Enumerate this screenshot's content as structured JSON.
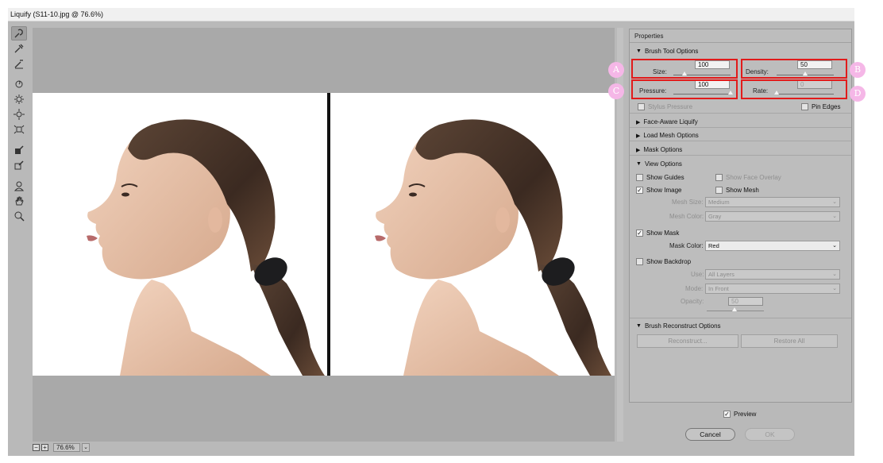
{
  "window": {
    "title": "Liquify (S11-10.jpg @ 76.6%)"
  },
  "toolbar": {
    "tools": [
      "forward-warp-icon",
      "reconstruct-icon",
      "smooth-icon",
      "twirl-icon",
      "pucker-icon",
      "bloat-icon",
      "push-left-icon",
      "freeze-mask-icon",
      "thaw-mask-icon",
      "face-tool-icon",
      "hand-icon",
      "zoom-icon"
    ]
  },
  "canvas": {
    "zoom_value": "76.6%",
    "zoom_out": "−",
    "zoom_in": "+",
    "dropdown_caret": "⌄"
  },
  "properties": {
    "title": "Properties",
    "brush_tool_options": {
      "heading": "Brush Tool Options",
      "size_label": "Size:",
      "size_value": "100",
      "size_level": 0.2,
      "density_label": "Density:",
      "density_value": "50",
      "density_level": 0.5,
      "pressure_label": "Pressure:",
      "pressure_value": "100",
      "pressure_level": 1.0,
      "rate_label": "Rate:",
      "rate_value": "0",
      "rate_level": 0.0,
      "stylus_pressure_label": "Stylus Pressure",
      "pin_edges_label": "Pin Edges"
    },
    "callouts": [
      "A",
      "B",
      "C",
      "D"
    ],
    "face_aware": "Face-Aware Liquify",
    "load_mesh": "Load Mesh Options",
    "mask_options": "Mask Options",
    "view_options": {
      "heading": "View Options",
      "show_guides": "Show Guides",
      "show_face_overlay": "Show Face Overlay",
      "show_image": "Show Image",
      "show_mesh": "Show Mesh",
      "mesh_size_label": "Mesh Size:",
      "mesh_size_value": "Medium",
      "mesh_color_label": "Mesh Color:",
      "mesh_color_value": "Gray",
      "show_mask": "Show Mask",
      "mask_color_label": "Mask Color:",
      "mask_color_value": "Red",
      "show_backdrop": "Show Backdrop",
      "use_label": "Use:",
      "use_value": "All Layers",
      "mode_label": "Mode:",
      "mode_value": "In Front",
      "opacity_label": "Opacity:",
      "opacity_value": "50"
    },
    "brush_reconstruct": {
      "heading": "Brush Reconstruct Options",
      "reconstruct_button": "Reconstruct...",
      "restore_all_button": "Restore All"
    }
  },
  "footer": {
    "preview_label": "Preview",
    "cancel_label": "Cancel",
    "ok_label": "OK"
  },
  "colors": {
    "highlight_box": "#e11b1b",
    "callout_badge": "#f5b7e7"
  }
}
